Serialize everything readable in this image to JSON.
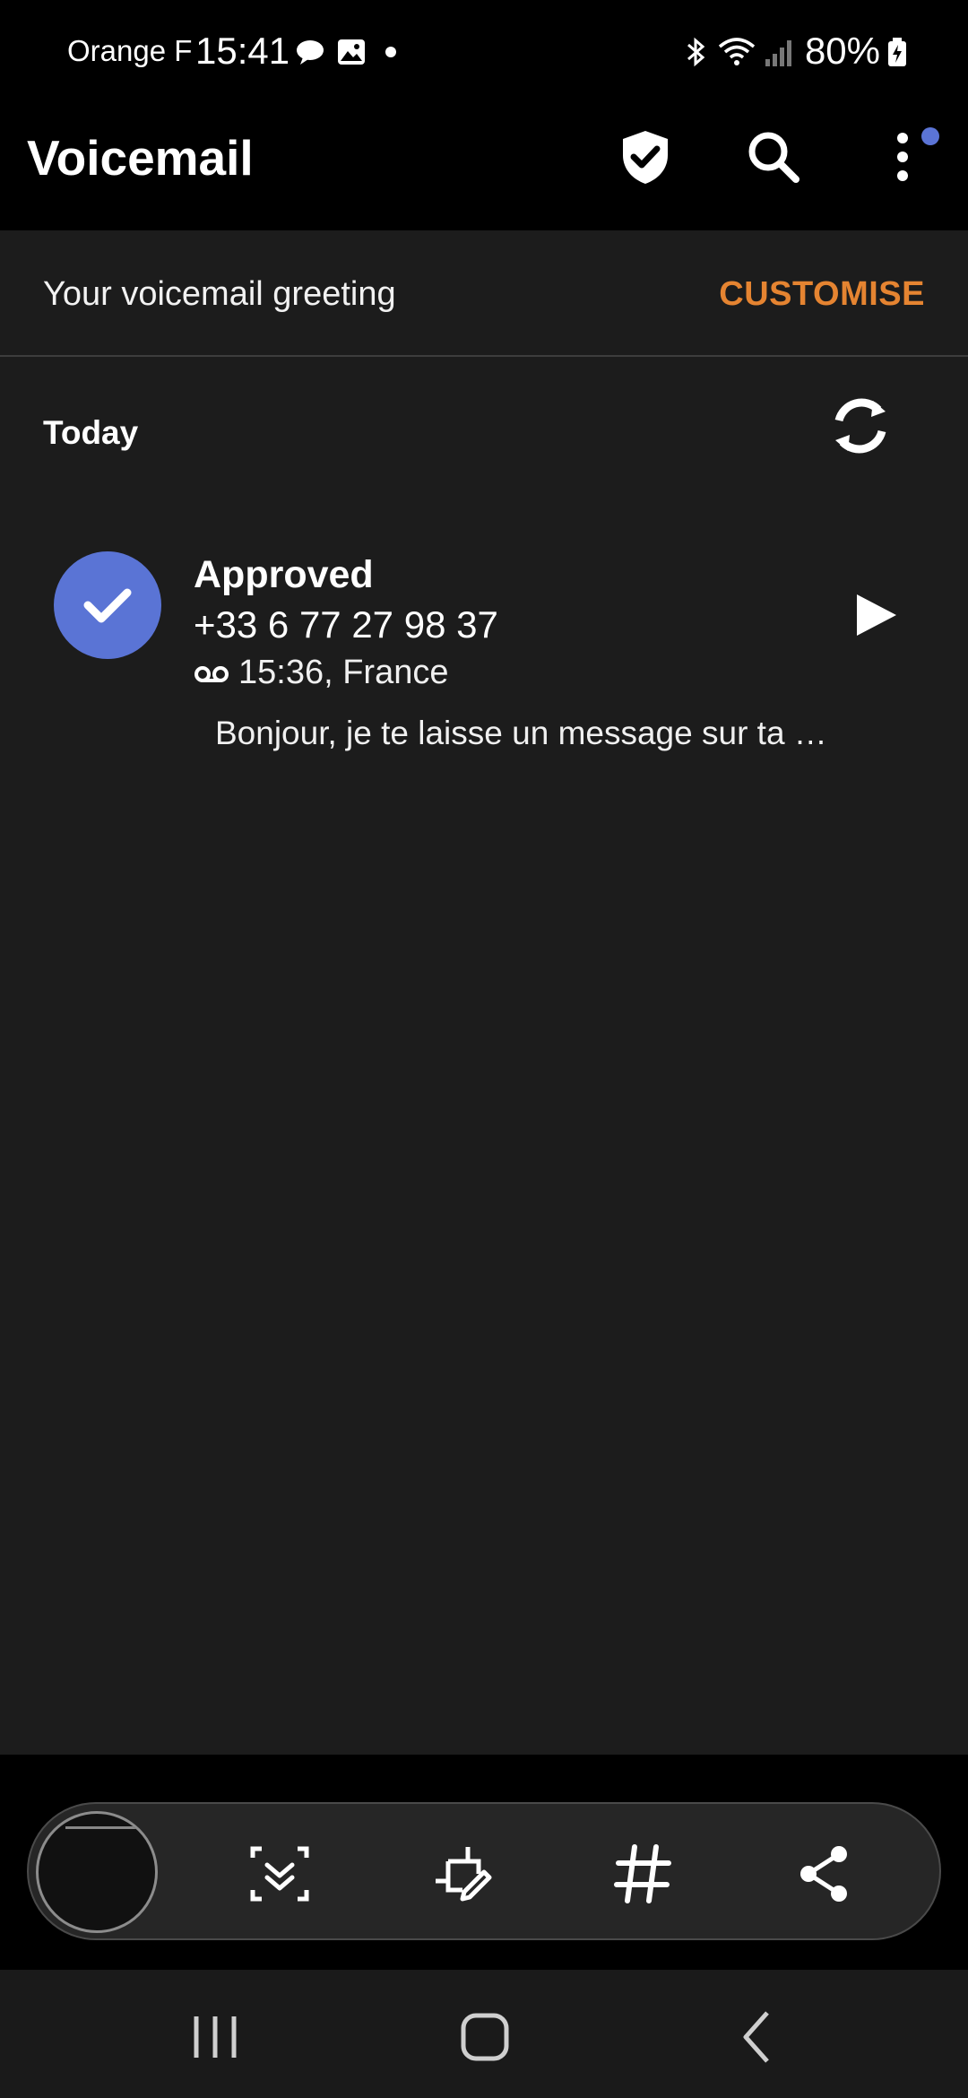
{
  "status_bar": {
    "carrier": "Orange F",
    "time": "15:41",
    "battery": "80%"
  },
  "app_bar": {
    "title": "Voicemail"
  },
  "greeting": {
    "label": "Your voicemail greeting",
    "action": "CUSTOMISE"
  },
  "section": {
    "label": "Today"
  },
  "voicemails": [
    {
      "status": "Approved",
      "number": "+33 6 77 27 98 37",
      "meta": "15:36, France",
      "transcript": "Bonjour, je te laisse un message sur ta …"
    }
  ],
  "colors": {
    "accent": "#e58431",
    "avatar": "#5a74d5",
    "background": "#1c1c1c"
  }
}
